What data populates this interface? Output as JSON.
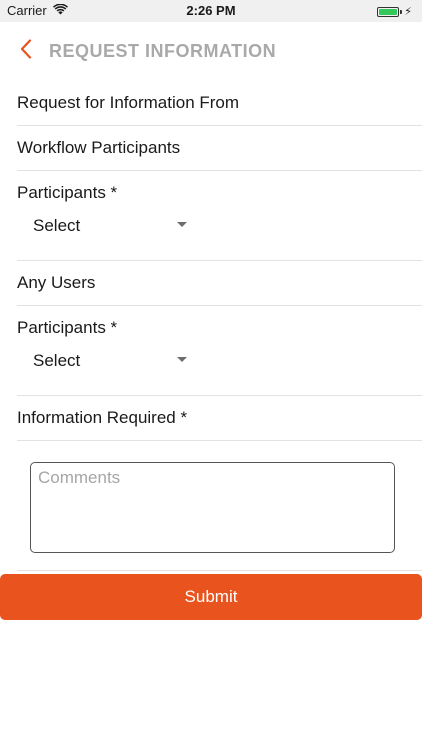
{
  "status_bar": {
    "carrier": "Carrier",
    "time": "2:26 PM",
    "battery_level": 1.0,
    "charging_symbol": "⚡"
  },
  "nav": {
    "back_icon": "chevron-left-icon",
    "title": "REQUEST INFORMATION",
    "accent_color": "#e9531d"
  },
  "form": {
    "request_from_label": "Request for Information From",
    "workflow_section": "Workflow Participants",
    "workflow_participants_label": "Participants *",
    "workflow_participants_select": "Select",
    "any_users_section": "Any Users",
    "any_users_participants_label": "Participants *",
    "any_users_participants_select": "Select",
    "information_required_label": "Information Required *",
    "comments_placeholder": "Comments",
    "comments_value": "",
    "submit_label": "Submit"
  }
}
